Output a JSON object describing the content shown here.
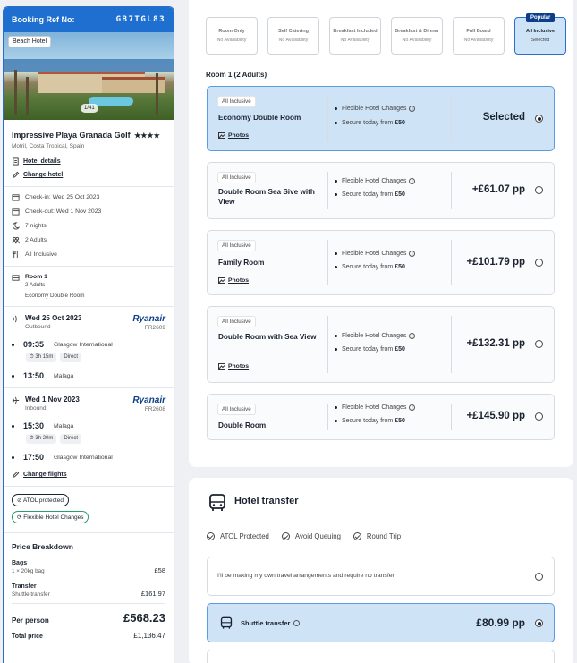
{
  "booking": {
    "label": "Booking Ref No:",
    "ref": "GB7TGL83"
  },
  "hotel": {
    "badge": "Beach Hotel",
    "photo_count": "1/41",
    "name": "Impressive Playa Granada Golf",
    "stars": "★★★★",
    "location": "Motril, Costa Tropical, Spain",
    "details_link": "Hotel details",
    "change_link": "Change hotel"
  },
  "stay": {
    "checkin": "Check-in: Wed 25 Oct 2023",
    "checkout": "Check-out: Wed 1 Nov 2023",
    "nights": "7 nights",
    "adults": "2 Adults",
    "board": "All Inclusive"
  },
  "room_summary": {
    "title": "Room 1",
    "adults": "2 Adults",
    "type": "Economy Double Room"
  },
  "outbound": {
    "date": "Wed 25 Oct 2023",
    "label": "Outbound",
    "airline": "Ryanair",
    "flight": "FR2609",
    "dep_time": "09:35",
    "dep_place": "Glasgow International",
    "duration": "3h 15m",
    "direct": "Direct",
    "arr_time": "13:50",
    "arr_place": "Malaga"
  },
  "inbound": {
    "date": "Wed 1 Nov 2023",
    "label": "Inbound",
    "airline": "Ryanair",
    "flight": "FR2608",
    "dep_time": "15:30",
    "dep_place": "Malaga",
    "duration": "3h 20m",
    "direct": "Direct",
    "arr_time": "17:50",
    "arr_place": "Glasgow International"
  },
  "change_flights": "Change flights",
  "badges": {
    "atol": "ATOL protected",
    "flexible": "Flexible Hotel Changes"
  },
  "price": {
    "title": "Price Breakdown",
    "bags_label": "Bags",
    "bags_sub": "1 × 20kg bag",
    "bags_val": "£58",
    "transfer_label": "Transfer",
    "transfer_sub": "Shuttle transfer",
    "transfer_val": "£161.97",
    "pp_label": "Per person",
    "pp_val": "£568.23",
    "total_label": "Total price",
    "total_val": "£1,136.47"
  },
  "boards": [
    {
      "name": "Room Only",
      "status": "No Availability"
    },
    {
      "name": "Self Catering",
      "status": "No Availability"
    },
    {
      "name": "Breakfast Included",
      "status": "No Availability"
    },
    {
      "name": "Breakfast & Dinner",
      "status": "No Availability"
    },
    {
      "name": "Full Board",
      "status": "No Availability"
    },
    {
      "name": "All Inclusive",
      "status": "Selected",
      "popular": "Popular"
    }
  ],
  "rooms_heading": "Room 1 (2 Adults)",
  "rooms": [
    {
      "tag": "All Inclusive",
      "name": "Economy Double Room",
      "photos": "Photos",
      "feat1": "Flexible Hotel Changes",
      "feat2": "Secure today from",
      "deposit": "£50",
      "price": "Selected"
    },
    {
      "tag": "All Inclusive",
      "name": "Double Room Sea Sive with View",
      "feat1": "Flexible Hotel Changes",
      "feat2": "Secure today from",
      "deposit": "£50",
      "price": "+£61.07 pp"
    },
    {
      "tag": "All Inclusive",
      "name": "Family Room",
      "photos": "Photos",
      "feat1": "Flexible Hotel Changes",
      "feat2": "Secure today from",
      "deposit": "£50",
      "price": "+£101.79 pp"
    },
    {
      "tag": "All Inclusive",
      "name": "Double Room with Sea View",
      "photos": "Photos",
      "feat1": "Flexible Hotel Changes",
      "feat2": "Secure today from",
      "deposit": "£50",
      "price": "+£132.31 pp"
    },
    {
      "tag": "All Inclusive",
      "name": "Double Room",
      "feat1": "Flexible Hotel Changes",
      "feat2": "Secure today from",
      "deposit": "£50",
      "price": "+£145.90 pp"
    }
  ],
  "transfer": {
    "title": "Hotel transfer",
    "features": [
      "ATOL Protected",
      "Avoid Queuing",
      "Round Trip"
    ],
    "own_arrangements": "I'll be making my own travel arrangements and require no transfer.",
    "shuttle_name": "Shuttle transfer",
    "shuttle_price": "£80.99 pp"
  },
  "colors": {
    "brand_blue": "#1e6fd0",
    "selected_bg": "#cfe3f7",
    "ryanair": "#0d3e8a"
  }
}
